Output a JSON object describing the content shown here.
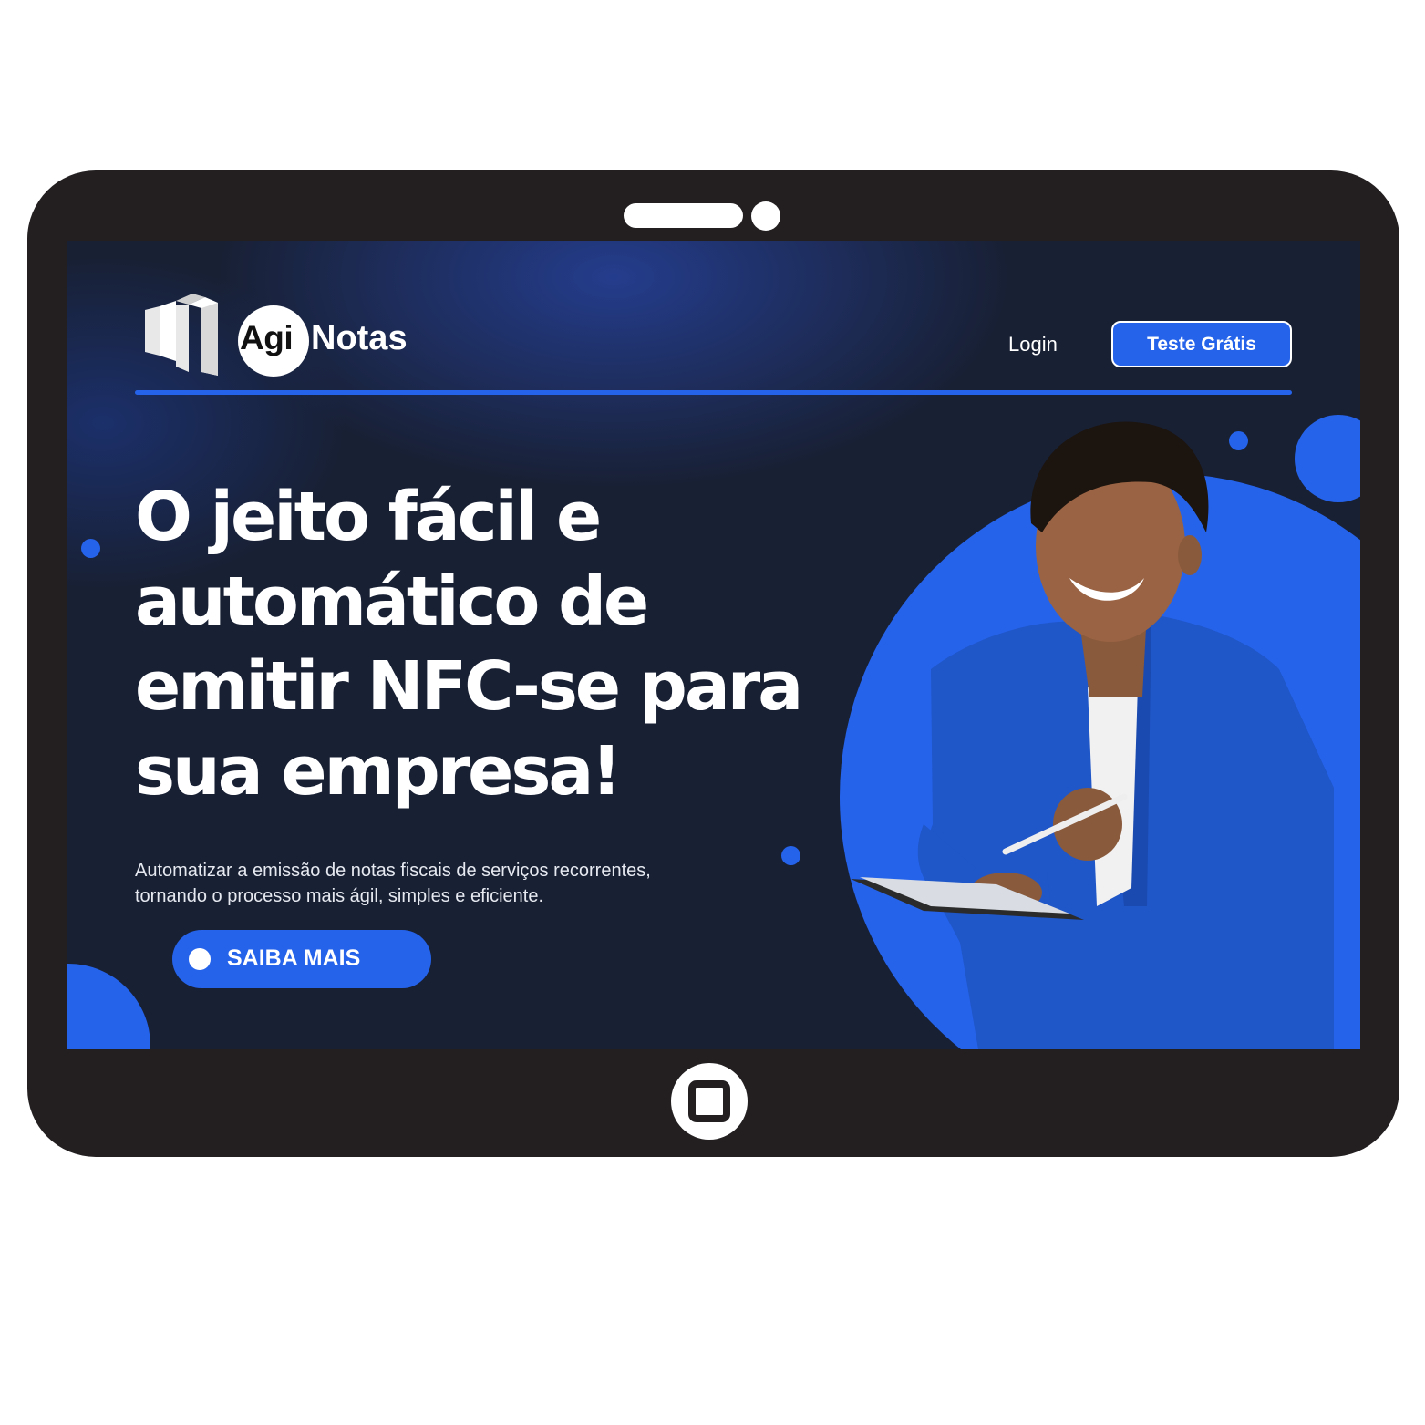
{
  "brand": {
    "agi": "Agi",
    "notas": "Notas"
  },
  "nav": {
    "login": "Login",
    "cta": "Teste Grátis"
  },
  "hero": {
    "headline_lines": [
      "O jeito fácil e",
      "automático de",
      "emitir NFC-se para",
      "sua empresa!"
    ],
    "subtitle_lines": [
      "Automatizar a emissão de notas fiscais de serviços recorrentes,",
      "tornando o processo mais ágil, simples e eficiente."
    ],
    "cta": "SAIBA MAIS"
  },
  "colors": {
    "accent": "#2563eb",
    "screen_bg": "#182034",
    "device_frame": "#231f20"
  },
  "icons": {
    "logo": "building-logo-icon",
    "home": "home-button-icon",
    "cta_dot": "dot-icon"
  }
}
